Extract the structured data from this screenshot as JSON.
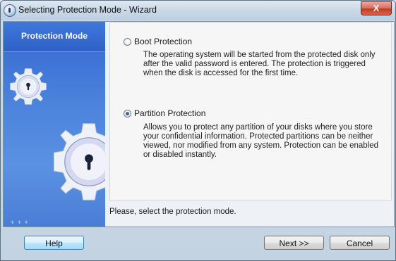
{
  "window": {
    "title": "Selecting Protection Mode - Wizard",
    "close_label": "X"
  },
  "sidebar": {
    "title": "Protection Mode",
    "dots": "+ + +"
  },
  "options": [
    {
      "label": "Boot Protection",
      "selected": false,
      "description": "The operating system will be started from the protected disk only after the valid password is entered. The protection is triggered when the disk is accessed for the first time."
    },
    {
      "label": "Partition Protection",
      "selected": true,
      "description": "Allows you to protect any partition of your disks where you store your confidential information. Protected partitions can be neither viewed, nor modified from any system. Protection can be enabled or disabled instantly."
    }
  ],
  "status_text": "Please, select the protection mode.",
  "buttons": {
    "help": "Help",
    "next": "Next >>",
    "cancel": "Cancel"
  },
  "icons": {
    "app": "lock-gear-icon",
    "sidebar_small": "lock-gear-icon",
    "sidebar_large": "lock-gear-icon"
  }
}
